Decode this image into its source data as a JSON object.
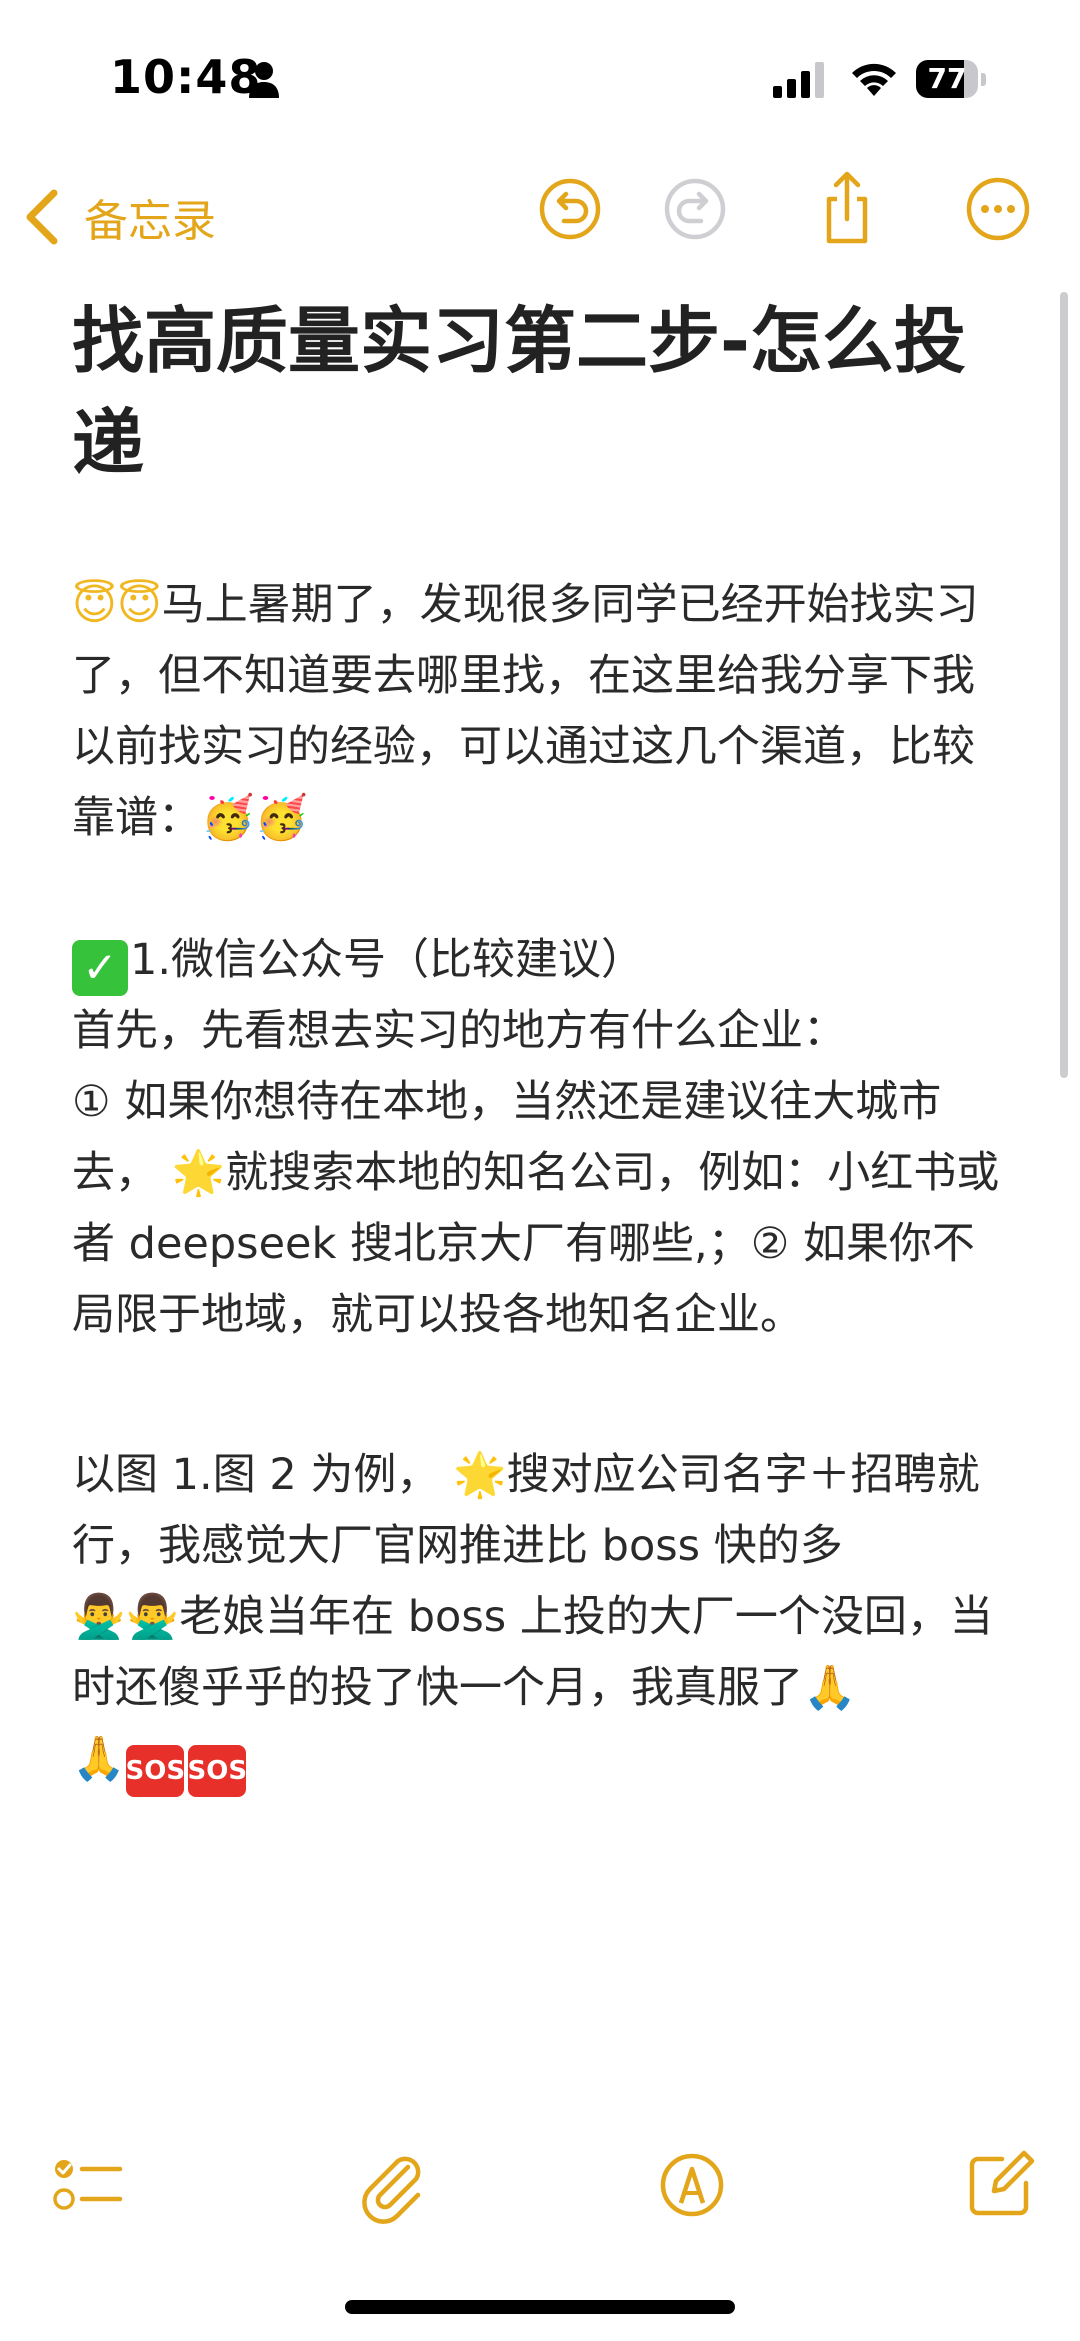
{
  "status_bar": {
    "time": "10:48",
    "battery": "77",
    "battery_level": 0.77,
    "icons": [
      "person-icon",
      "cellular-signal-icon",
      "wifi-icon",
      "battery-icon"
    ]
  },
  "nav": {
    "back_label": "备忘录",
    "icons": [
      "chevron-left-icon",
      "undo-icon",
      "redo-icon",
      "share-icon",
      "more-icon"
    ]
  },
  "note": {
    "title": "找高质量实习第二步-怎么投递",
    "intro_emoji": "😇😇",
    "intro_text": "马上暑期了，发现很多同学已经开始找实习了，但不知道要去哪里找，在这里给我分享下我以前找实习的经验，可以通过这几个渠道，比较靠谱：",
    "intro_end_emoji": "🥳🥳",
    "section1_heading": "1.微信公众号（比较建议）",
    "section1_line1": "首先，先看想去实习的地方有什么企业：",
    "section1_line2_a": "① 如果你想待在本地，当然还是建议往大城市去，",
    "section1_line2_b": "就搜索本地的知名公司，例如：小红书或者 deepseek 搜北京大厂有哪些,；② 如果你不局限于地域，就可以投各地知名企业。",
    "para3_a": "以图 1.图 2 为例，",
    "para3_b": "搜对应公司名字＋招聘就行，我感觉大厂官网推进比 boss 快的多",
    "para3_c": "老娘当年在 boss 上投的大厂一个没回，当时还傻乎乎的投了快一个月，我真服了",
    "sos_label": "SOS"
  },
  "colors": {
    "accent": "#e3a51a",
    "text": "#2a2a2a",
    "check_green": "#37c23b",
    "sos_red": "#e8302b"
  },
  "toolbar": {
    "icons": [
      "checklist-icon",
      "paperclip-icon",
      "markup-pen-icon",
      "compose-icon"
    ]
  }
}
